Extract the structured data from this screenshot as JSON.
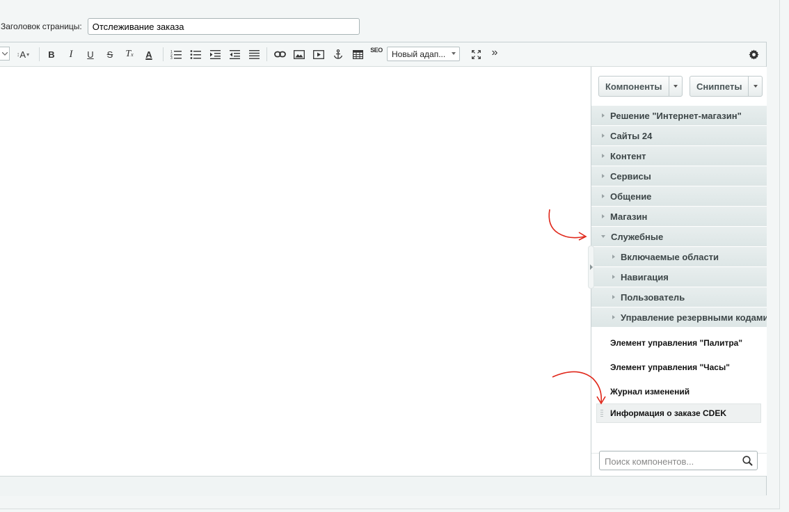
{
  "page_title": {
    "label": "Заголовок страницы:",
    "value": "Отслеживание заказа"
  },
  "toolbar": {
    "font_size_label": "A",
    "bold": "B",
    "italic": "I",
    "underline": "U",
    "strike": "S",
    "remove_format": "T",
    "font_color": "A",
    "seo": "SEO",
    "style_select_value": "Новый адап...",
    "more": "»"
  },
  "taskbar": {
    "components_label": "Компоненты",
    "snippets_label": "Сниппеты",
    "categories": [
      {
        "label": "Решение \"Интернет-магазин\""
      },
      {
        "label": "Сайты 24"
      },
      {
        "label": "Контент"
      },
      {
        "label": "Сервисы"
      },
      {
        "label": "Общение"
      },
      {
        "label": "Магазин"
      },
      {
        "label": "Служебные"
      }
    ],
    "subcategories": [
      {
        "label": "Включаемые области"
      },
      {
        "label": "Навигация"
      },
      {
        "label": "Пользователь"
      },
      {
        "label": "Управление резервными кодами"
      }
    ],
    "leaves": [
      {
        "label": "Элемент управления \"Палитра\""
      },
      {
        "label": "Элемент управления \"Часы\""
      },
      {
        "label": "Журнал изменений"
      },
      {
        "label": "Информация о заказе CDEK"
      }
    ],
    "search_placeholder": "Поиск компонентов..."
  },
  "colors": {
    "annotation_arrow": "#e0271a",
    "category_bg": "#e2eaea",
    "selected_bg": "#eef1f1"
  }
}
